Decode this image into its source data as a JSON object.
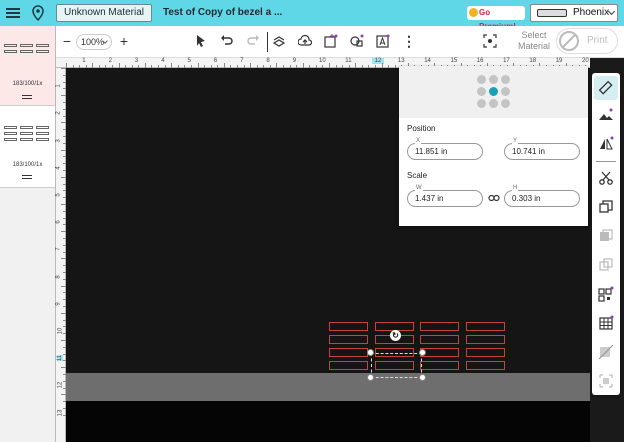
{
  "topbar": {
    "material_button": "Unknown Material",
    "project_title": "Test of Copy of bezel a ...",
    "premium_label": "Go Premium!",
    "machine_name": "Phoenix"
  },
  "toolbar": {
    "zoom": "100%",
    "select_material": "Select Material",
    "print": "Print"
  },
  "pages": [
    {
      "caption": "183/100/1x",
      "active": true
    },
    {
      "caption": "183/100/1x",
      "active": false
    }
  ],
  "ruler": {
    "top_ticks": [
      "1",
      "2",
      "3",
      "4",
      "5",
      "6",
      "7",
      "8",
      "9",
      "10",
      "11",
      "12",
      "13",
      "14",
      "15",
      "16",
      "17",
      "18",
      "19",
      "20"
    ],
    "left_ticks": [
      "1",
      "2",
      "3",
      "4",
      "5",
      "6",
      "7",
      "8",
      "9",
      "10",
      "11",
      "12",
      "13"
    ],
    "highlight_top": "12",
    "highlight_left": "11"
  },
  "position": {
    "section_label": "Position",
    "x_label": "X",
    "x_value": "11.851 in",
    "y_label": "Y",
    "y_value": "10.741 in"
  },
  "scale": {
    "section_label": "Scale",
    "w_label": "W",
    "w_value": "1.437 in",
    "h_label": "H",
    "h_value": "0.303 in"
  },
  "colors": {
    "accent": "#5fd7e7",
    "cut_line": "#c4443d",
    "selected_dot": "#1aa1b5",
    "premium_dot": "#8e3fb8"
  },
  "right_tools": [
    "ruler-icon",
    "landscape-icon",
    "flip-icon",
    "scissors-icon",
    "duplicate-icon",
    "group-icon",
    "ungroup-icon",
    "qr-code-icon",
    "table-icon",
    "slice-icon",
    "align-icon"
  ]
}
